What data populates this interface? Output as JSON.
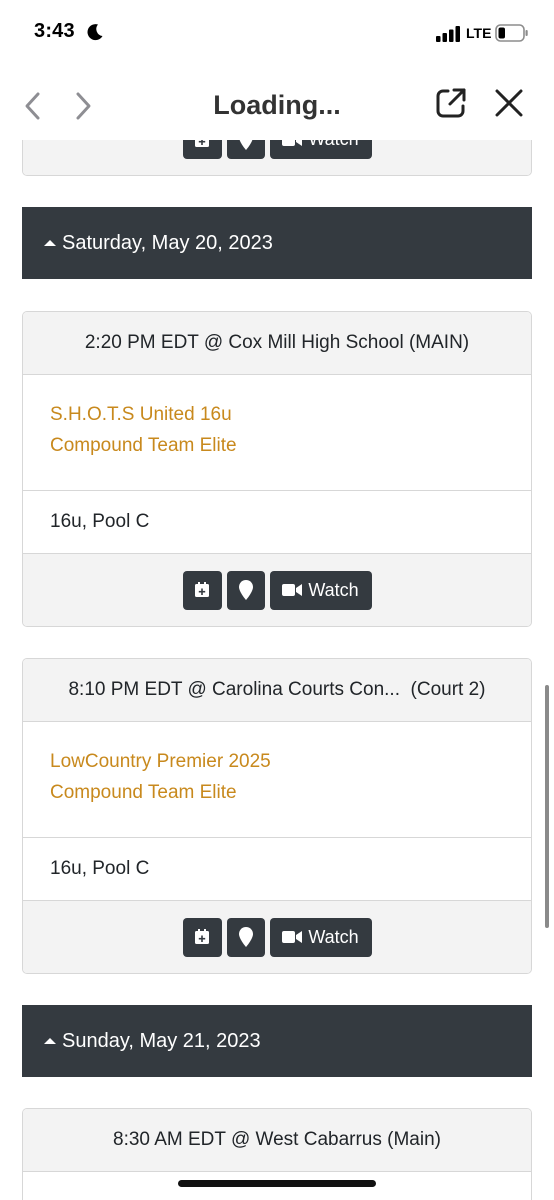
{
  "status_bar": {
    "time": "3:43",
    "network": "LTE"
  },
  "nav": {
    "title": "Loading..."
  },
  "partial_card": {
    "watch_label": "Watch"
  },
  "days": [
    {
      "label": "Saturday, May 20, 2023"
    },
    {
      "label": "Sunday, May 21, 2023"
    }
  ],
  "games": [
    {
      "header": "2:20 PM EDT @ Cox Mill High School (MAIN)",
      "team1": "S.H.O.T.S United 16u",
      "team2": "Compound Team Elite",
      "division": "16u, Pool C",
      "watch_label": "Watch"
    },
    {
      "header": "8:10 PM EDT @ Carolina Courts Con...  (Court 2)",
      "team1": "LowCountry Premier 2025",
      "team2": "Compound Team Elite",
      "division": "16u, Pool C",
      "watch_label": "Watch"
    },
    {
      "header": "8:30 AM EDT @ West Cabarrus (Main)"
    }
  ],
  "colors": {
    "team_link": "#c8891d",
    "dark": "#343a40",
    "header_bg": "#f3f3f3"
  }
}
